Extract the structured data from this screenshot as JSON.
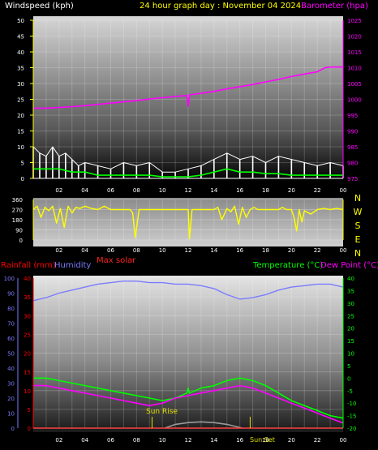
{
  "colors": {
    "wind": "#ffffff",
    "wind_avg": "#00ff00",
    "barometer": "#ff00ff",
    "direction": "#ffff00",
    "rainfall": "#ff0000",
    "humidity": "#7b7bff",
    "max_solar": "#ff2020",
    "temperature": "#00ff00",
    "dew_point": "#ff00ff",
    "solar_curve": "#9a9a9a",
    "sun_marker": "#e0e000",
    "tick": "#ffff00"
  },
  "header": {
    "wind_title": "Windspeed (kph)",
    "graph_title": "24 hour graph day : November 04 2024",
    "baro_title": "Barometer (hpa)"
  },
  "labels": {
    "rainfall": "Rainfall (mm)",
    "humidity": "Humidity",
    "max_solar": "Max solar",
    "temperature": "Temperature (°C)",
    "dew_point": "Dew Point (°C)",
    "sun_rise": "Sun Rise",
    "sun_set": "Sun Set"
  },
  "chart_data": [
    {
      "type": "line",
      "panel": "wind-barometer",
      "x_ticks": [
        "02",
        "04",
        "06",
        "08",
        "10",
        "12",
        "14",
        "16",
        "18",
        "20",
        "22",
        "00"
      ],
      "xlim": [
        0,
        24
      ],
      "y_left": {
        "label": "Windspeed (kph)",
        "ylim": [
          0,
          50
        ],
        "ticks": [
          "0",
          "5",
          "10",
          "15",
          "20",
          "25",
          "30",
          "35",
          "40",
          "45",
          "50"
        ]
      },
      "y_right": {
        "label": "Barometer (hpa)",
        "ylim": [
          975,
          1025
        ],
        "ticks": [
          "975",
          "980",
          "985",
          "990",
          "995",
          "1000",
          "1005",
          "1010",
          "1015",
          "1020",
          "1025"
        ]
      },
      "series": [
        {
          "name": "Barometer",
          "axis": "right",
          "x": [
            0,
            1,
            2,
            3,
            4,
            5,
            6,
            7,
            8,
            9,
            10,
            11,
            11.9,
            12,
            12.1,
            13,
            14,
            15,
            16,
            17,
            18,
            19,
            20,
            21,
            22,
            22.6,
            23,
            24
          ],
          "y": [
            997.2,
            997.2,
            997.4,
            997.7,
            998,
            998.4,
            998.8,
            999.2,
            999.6,
            1000.1,
            1000.5,
            1000.9,
            1001.2,
            997.8,
            1001.4,
            1001.9,
            1002.5,
            1003.3,
            1004,
            1004.7,
            1005.5,
            1006.3,
            1007.2,
            1008,
            1008.7,
            1010,
            1010.2,
            1010.2
          ]
        },
        {
          "name": "Wind gust",
          "axis": "left",
          "x": [
            0,
            0.5,
            1,
            1.5,
            2,
            2.5,
            3,
            3.5,
            4,
            5,
            6,
            7,
            8,
            9,
            10,
            11,
            12,
            13,
            14,
            15,
            16,
            17,
            18,
            19,
            20,
            21,
            22,
            23,
            24
          ],
          "y": [
            10,
            8,
            7,
            10,
            7,
            8,
            6,
            4,
            5,
            4,
            3,
            5,
            4,
            5,
            2,
            2,
            3,
            4,
            6,
            8,
            6,
            7,
            5,
            7,
            6,
            5,
            4,
            5,
            4
          ]
        },
        {
          "name": "Wind average",
          "axis": "left",
          "x": [
            0,
            1,
            2,
            3,
            4,
            5,
            6,
            7,
            8,
            9,
            10,
            11,
            12,
            13,
            14,
            15,
            16,
            17,
            18,
            19,
            20,
            21,
            22,
            23,
            24
          ],
          "y": [
            3,
            3,
            3,
            2,
            2,
            1,
            1,
            1,
            1,
            1,
            0.5,
            0.5,
            0.5,
            1,
            2,
            3,
            2,
            2,
            1.5,
            1.5,
            1,
            1,
            1,
            1,
            1
          ]
        }
      ]
    },
    {
      "type": "line",
      "panel": "wind-direction",
      "x_ticks": [
        "02",
        "04",
        "06",
        "08",
        "10",
        "12",
        "14",
        "16",
        "18",
        "20",
        "22",
        "00"
      ],
      "xlim": [
        0,
        24
      ],
      "y_left": {
        "ylim": [
          0,
          360
        ],
        "ticks": [
          "0",
          "90",
          "180",
          "270",
          "360"
        ]
      },
      "y_right": {
        "ticks": [
          "N",
          "W",
          "S",
          "E",
          "N"
        ]
      },
      "series": [
        {
          "name": "Wind direction",
          "x": [
            0,
            0.3,
            0.6,
            0.9,
            1.2,
            1.5,
            1.8,
            2.1,
            2.4,
            2.7,
            3,
            3.3,
            3.6,
            4,
            4.5,
            5,
            5.5,
            6,
            7,
            7.5,
            7.7,
            7.9,
            8.2,
            9,
            10,
            11,
            12,
            12.1,
            12.3,
            12.5,
            13,
            14,
            14.3,
            14.6,
            15,
            15.3,
            15.6,
            15.9,
            16.2,
            16.5,
            16.8,
            17.1,
            17.4,
            18,
            19,
            19.3,
            19.6,
            20,
            20.2,
            20.4,
            20.6,
            20.8,
            21,
            21.5,
            22,
            22.5,
            23,
            23.5,
            24
          ],
          "y": [
            270,
            300,
            200,
            290,
            260,
            300,
            150,
            280,
            110,
            300,
            240,
            290,
            280,
            300,
            280,
            270,
            300,
            270,
            270,
            270,
            240,
            20,
            270,
            270,
            270,
            270,
            270,
            10,
            270,
            270,
            270,
            270,
            290,
            180,
            280,
            250,
            300,
            140,
            290,
            200,
            270,
            290,
            270,
            270,
            270,
            290,
            270,
            270,
            200,
            80,
            270,
            160,
            260,
            230,
            270,
            280,
            270,
            280,
            270
          ]
        }
      ]
    },
    {
      "type": "line",
      "panel": "temp-humidity",
      "x_ticks": [
        "02",
        "04",
        "06",
        "08",
        "10",
        "12",
        "14",
        "16",
        "18",
        "20",
        "22",
        "00"
      ],
      "xlim": [
        0,
        24
      ],
      "y_left_rain": {
        "label": "Rainfall (mm)",
        "ylim": [
          0,
          40
        ],
        "ticks": [
          "0",
          "5",
          "10",
          "15",
          "20",
          "25",
          "30",
          "35",
          "40"
        ]
      },
      "y_left_humidity": {
        "label": "Humidity",
        "ylim": [
          0,
          100
        ],
        "ticks": [
          "0",
          "10",
          "20",
          "30",
          "40",
          "50",
          "60",
          "70",
          "80",
          "90",
          "100"
        ]
      },
      "y_right": {
        "label": "Temperature (°C)",
        "ylim": [
          -20,
          40
        ],
        "ticks": [
          "-20",
          "-15",
          "-10",
          "-5",
          "0",
          "5",
          "10",
          "15",
          "20",
          "25",
          "30",
          "35",
          "40"
        ]
      },
      "series": [
        {
          "name": "Humidity",
          "axis": "humidity",
          "x": [
            0,
            1,
            2,
            3,
            4,
            5,
            6,
            7,
            8,
            9,
            10,
            11,
            12,
            13,
            14,
            15,
            16,
            17,
            18,
            19,
            20,
            21,
            22,
            23,
            24
          ],
          "y": [
            85,
            87,
            90,
            92,
            94,
            96,
            97,
            98,
            98,
            97,
            97,
            96,
            96,
            95,
            93,
            89,
            86,
            87,
            89,
            92,
            94,
            95,
            96,
            96,
            94
          ]
        },
        {
          "name": "Temperature",
          "axis": "right",
          "x": [
            0,
            1,
            2,
            3,
            4,
            5,
            6,
            7,
            8,
            9,
            10,
            11,
            11.9,
            12,
            12.1,
            13,
            14,
            15,
            16,
            17,
            18,
            19,
            20,
            21,
            22,
            23,
            24
          ],
          "y": [
            0,
            0,
            -1,
            -2,
            -3,
            -4,
            -5,
            -6,
            -7,
            -8,
            -9,
            -8,
            -6,
            -4,
            -6,
            -4,
            -3,
            -1,
            0,
            -1,
            -3,
            -6,
            -9,
            -11,
            -13,
            -15,
            -16
          ]
        },
        {
          "name": "Dew Point",
          "axis": "right",
          "x": [
            0,
            1,
            2,
            3,
            4,
            5,
            6,
            7,
            8,
            9,
            10,
            11,
            12,
            13,
            14,
            15,
            16,
            17,
            18,
            19,
            20,
            21,
            22,
            23,
            24
          ],
          "y": [
            -3,
            -3,
            -4,
            -5,
            -6,
            -7,
            -8,
            -9,
            -10,
            -11,
            -10,
            -8,
            -7,
            -6,
            -5,
            -4,
            -3,
            -4,
            -6,
            -8,
            -10,
            -12,
            -14,
            -16,
            -18
          ]
        },
        {
          "name": "Rainfall",
          "axis": "rain",
          "x": [
            0,
            24
          ],
          "y": [
            0,
            0
          ]
        },
        {
          "name": "Max solar",
          "axis": "right",
          "x": [
            10.2,
            11,
            12,
            13,
            14,
            15,
            16.2
          ],
          "y": [
            -20,
            -18.5,
            -17.8,
            -17.5,
            -17.8,
            -18.5,
            -20
          ]
        }
      ],
      "annotations": [
        {
          "text": "Sun Rise",
          "x": 9.2
        },
        {
          "text": "Sun Set",
          "x": 16.8
        }
      ]
    }
  ]
}
